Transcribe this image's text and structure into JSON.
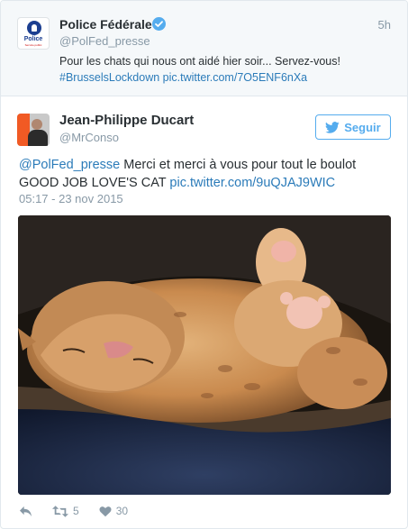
{
  "quoted_tweet": {
    "display_name": "Police Fédérale",
    "handle": "@PolFed_presse",
    "time": "5h",
    "text": "Pour les chats qui nous ont aidé hier soir... Servez-vous!",
    "hashtag": "#BrusselsLockdown",
    "link": "pic.twitter.com/7O5ENF6nXa",
    "avatar_logo_text": "Police",
    "avatar_logo_subtext": "Service public"
  },
  "tweet": {
    "display_name": "Jean-Philippe Ducart",
    "handle": "@MrConso",
    "follow_label": "Seguir",
    "mention": "@PolFed_presse",
    "text_line1": " Merci et merci à vous pour tout le boulot",
    "text_line2": "GOOD JOB LOVE'S CAT ",
    "link": "pic.twitter.com/9uQJAJ9WIC",
    "date": "05:17 - 23 nov 2015"
  },
  "actions": {
    "retweet_count": "5",
    "like_count": "30"
  },
  "colors": {
    "link_blue": "#2b7bb9",
    "accent": "#55acee",
    "muted": "#8899a6"
  }
}
